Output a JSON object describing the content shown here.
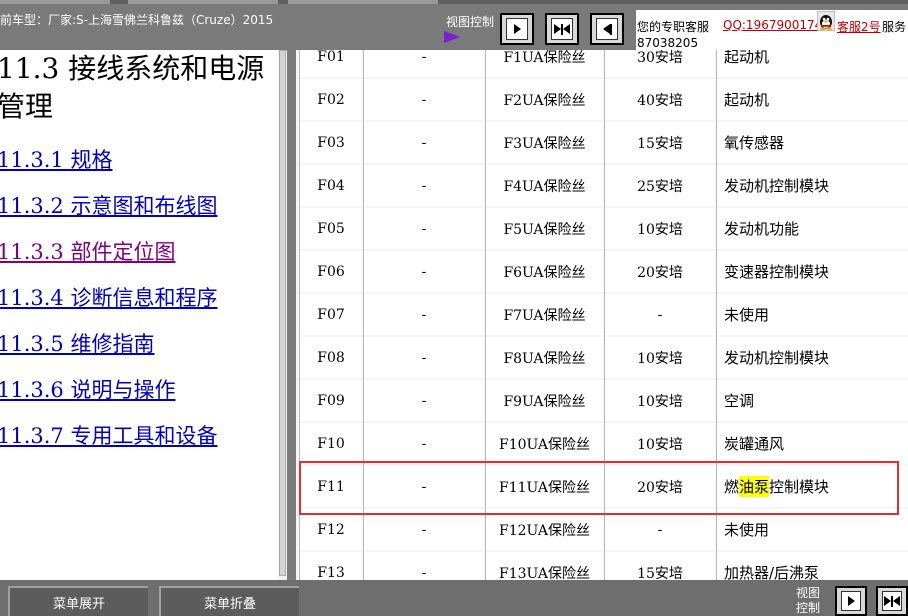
{
  "toolbar": {
    "car_model": "前车型：厂家:S-上海雪佛兰科鲁兹（Cruze）2015",
    "view_control_label": "视图控制"
  },
  "service": {
    "text": "您的专职客服",
    "qq": "QQ:1967900174",
    "name": "客服2号",
    "suffix": "服务",
    "phone": "87038205"
  },
  "left_menu": {
    "title": "11.3 接线系统和电源管理",
    "items": [
      {
        "label": "11.3.1 规格"
      },
      {
        "label": "11.3.2 示意图和布线图"
      },
      {
        "label": "11.3.3 部件定位图"
      },
      {
        "label": "11.3.4 诊断信息和程序"
      },
      {
        "label": "11.3.5 维修指南"
      },
      {
        "label": "11.3.6 说明与操作"
      },
      {
        "label": "11.3.7 专用工具和设备"
      }
    ]
  },
  "fuse_table": {
    "rows": [
      [
        "F01",
        "-",
        "F1UA保险丝",
        "30安培",
        "起动机"
      ],
      [
        "F02",
        "-",
        "F2UA保险丝",
        "40安培",
        "起动机"
      ],
      [
        "F03",
        "-",
        "F3UA保险丝",
        "15安培",
        "氧传感器"
      ],
      [
        "F04",
        "-",
        "F4UA保险丝",
        "25安培",
        "发动机控制模块"
      ],
      [
        "F05",
        "-",
        "F5UA保险丝",
        "10安培",
        "发动机功能"
      ],
      [
        "F06",
        "-",
        "F6UA保险丝",
        "20安培",
        "变速器控制模块"
      ],
      [
        "F07",
        "-",
        "F7UA保险丝",
        "-",
        "未使用"
      ],
      [
        "F08",
        "-",
        "F8UA保险丝",
        "10安培",
        "发动机控制模块"
      ],
      [
        "F09",
        "-",
        "F9UA保险丝",
        "10安培",
        "空调"
      ],
      [
        "F10",
        "-",
        "F10UA保险丝",
        "10安培",
        "炭罐通风"
      ],
      [
        "F11",
        "-",
        "F11UA保险丝",
        "20安培",
        "燃油泵控制模块"
      ],
      [
        "F12",
        "-",
        "F12UA保险丝",
        "-",
        "未使用"
      ],
      [
        "F13",
        "-",
        "F13UA保险丝",
        "15安培",
        "加热器/后沸泵"
      ]
    ],
    "highlight": {
      "pre": "燃",
      "hl": "油泵",
      "post": "控制模块"
    }
  },
  "bottom": {
    "expand_label": "菜单展开",
    "collapse_label": "菜单折叠",
    "view_control_label": "视图控制"
  },
  "colors": {
    "toolbar_bg": "#7a7a7a",
    "link": "#0000cc",
    "visited_link": "#800080",
    "highlight": "#ffff00",
    "red_box": "#e03030",
    "qq_red": "#c00000"
  }
}
